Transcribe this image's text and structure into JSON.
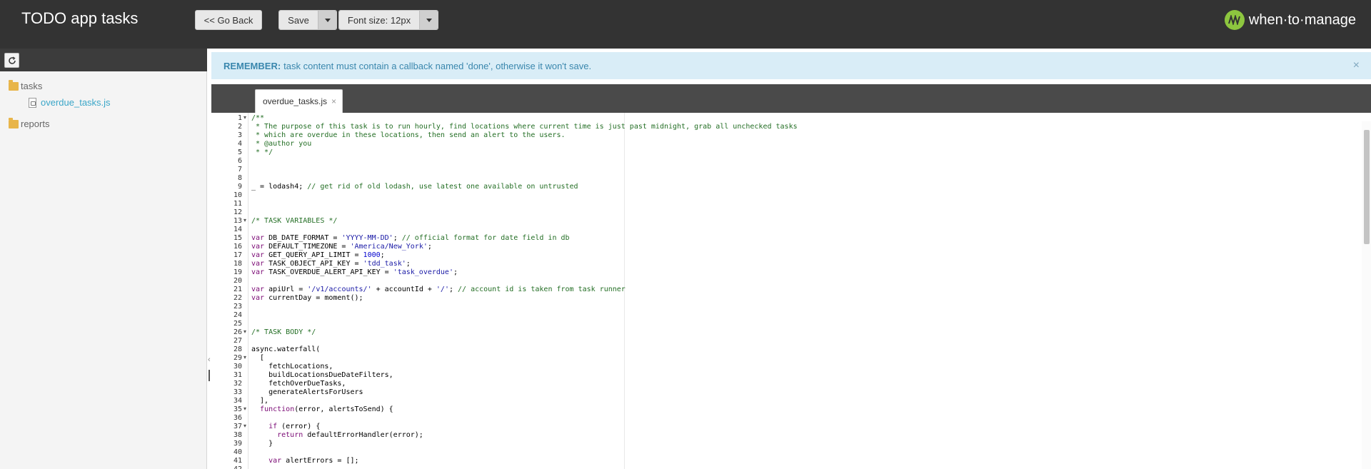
{
  "header": {
    "title": "TODO app tasks",
    "go_back_label": "<< Go Back",
    "save_label": "Save",
    "font_size_label": "Font size: 12px",
    "brand_name": "when·to·manage",
    "brand_color": "#8dc63f"
  },
  "sidebar": {
    "refresh_icon": "refresh-icon",
    "tree": [
      {
        "label": "tasks",
        "type": "folder"
      },
      {
        "label": "overdue_tasks.js",
        "type": "file"
      },
      {
        "label": "reports",
        "type": "folder"
      }
    ]
  },
  "alert": {
    "strong": "REMEMBER:",
    "text": "task content must contain a callback named 'done', otherwise it won't save.",
    "close_symbol": "×"
  },
  "editor": {
    "tab_label": "overdue_tasks.js",
    "tab_close_symbol": "×",
    "fold_lines": [
      1,
      13,
      26,
      29,
      35,
      37
    ],
    "lines": [
      [
        [
          "c",
          "/**"
        ]
      ],
      [
        [
          "c",
          " * The purpose of this task is to run hourly, find locations where current time is just past midnight, grab all unchecked tasks"
        ]
      ],
      [
        [
          "c",
          " * which are overdue in these locations, then send an alert to the users."
        ]
      ],
      [
        [
          "c",
          " * @author you"
        ]
      ],
      [
        [
          "c",
          " * */"
        ]
      ],
      [],
      [],
      [],
      [
        [
          "t",
          "_ = lodash4; "
        ],
        [
          "c",
          "// get rid of old lodash, use latest one available on untrusted"
        ]
      ],
      [],
      [],
      [],
      [
        [
          "c",
          "/* TASK VARIABLES */"
        ]
      ],
      [],
      [
        [
          "k",
          "var"
        ],
        [
          "t",
          " DB_DATE_FORMAT = "
        ],
        [
          "s",
          "'YYYY-MM-DD'"
        ],
        [
          "t",
          "; "
        ],
        [
          "c",
          "// official format for date field in db"
        ]
      ],
      [
        [
          "k",
          "var"
        ],
        [
          "t",
          " DEFAULT_TIMEZONE = "
        ],
        [
          "s",
          "'America/New_York'"
        ],
        [
          "t",
          ";"
        ]
      ],
      [
        [
          "k",
          "var"
        ],
        [
          "t",
          " GET_QUERY_API_LIMIT = "
        ],
        [
          "n",
          "1000"
        ],
        [
          "t",
          ";"
        ]
      ],
      [
        [
          "k",
          "var"
        ],
        [
          "t",
          " TASK_OBJECT_API_KEY = "
        ],
        [
          "s",
          "'tdd_task'"
        ],
        [
          "t",
          ";"
        ]
      ],
      [
        [
          "k",
          "var"
        ],
        [
          "t",
          " TASK_OVERDUE_ALERT_API_KEY = "
        ],
        [
          "s",
          "'task_overdue'"
        ],
        [
          "t",
          ";"
        ]
      ],
      [],
      [
        [
          "k",
          "var"
        ],
        [
          "t",
          " apiUrl = "
        ],
        [
          "s",
          "'/v1/accounts/'"
        ],
        [
          "t",
          " + accountId + "
        ],
        [
          "s",
          "'/'"
        ],
        [
          "t",
          "; "
        ],
        [
          "c",
          "// account id is taken from task runner"
        ]
      ],
      [
        [
          "k",
          "var"
        ],
        [
          "t",
          " currentDay = moment();"
        ]
      ],
      [],
      [],
      [],
      [
        [
          "c",
          "/* TASK BODY */"
        ]
      ],
      [],
      [
        [
          "t",
          "async.waterfall("
        ]
      ],
      [
        [
          "t",
          "  ["
        ]
      ],
      [
        [
          "t",
          "    fetchLocations,"
        ]
      ],
      [
        [
          "t",
          "    buildLocationsDueDateFilters,"
        ]
      ],
      [
        [
          "t",
          "    fetchOverDueTasks,"
        ]
      ],
      [
        [
          "t",
          "    generateAlertsForUsers"
        ]
      ],
      [
        [
          "t",
          "  ],"
        ]
      ],
      [
        [
          "t",
          "  "
        ],
        [
          "k",
          "function"
        ],
        [
          "t",
          "(error, alertsToSend) {"
        ]
      ],
      [],
      [
        [
          "t",
          "    "
        ],
        [
          "k",
          "if"
        ],
        [
          "t",
          " (error) {"
        ]
      ],
      [
        [
          "t",
          "      "
        ],
        [
          "k",
          "return"
        ],
        [
          "t",
          " defaultErrorHandler(error);"
        ]
      ],
      [
        [
          "t",
          "    }"
        ]
      ],
      [],
      [
        [
          "t",
          "    "
        ],
        [
          "k",
          "var"
        ],
        [
          "t",
          " alertErrors = [];"
        ]
      ],
      []
    ]
  }
}
